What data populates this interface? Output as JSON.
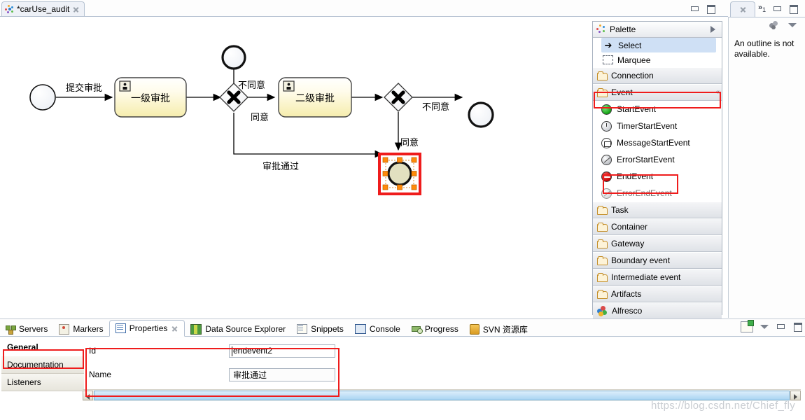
{
  "editor": {
    "tab_title": "*carUse_audit",
    "tab_icon": "bpmn-diagram-icon",
    "close_icon": "close-icon",
    "minimize_label": "minimize-icon",
    "maximize_label": "maximize-icon"
  },
  "diagram": {
    "nodes": [
      {
        "id": "startevent1",
        "type": "start-event",
        "label": ""
      },
      {
        "id": "usertask1",
        "type": "user-task",
        "label": "一级审批"
      },
      {
        "id": "exclusivegateway1",
        "type": "exclusive-gateway",
        "label": ""
      },
      {
        "id": "endevent1",
        "type": "end-event",
        "label": ""
      },
      {
        "id": "usertask2",
        "type": "user-task",
        "label": "二级审批"
      },
      {
        "id": "exclusivegateway2",
        "type": "exclusive-gateway",
        "label": ""
      },
      {
        "id": "endevent3",
        "type": "end-event",
        "label": ""
      },
      {
        "id": "endevent2",
        "type": "end-event",
        "label": "审批通过",
        "selected": true
      }
    ],
    "flow_labels": {
      "submit": "提交审批",
      "reject1": "不同意",
      "approve1": "同意",
      "reject2": "不同意",
      "approve2": "同意",
      "passed": "审批通过"
    },
    "selection_color": "#ef1c1c",
    "handle_color": "#ff8a0a"
  },
  "palette": {
    "title": "Palette",
    "title_icon": "palette-icon",
    "expand_icon": "chevron-right-icon",
    "tools": [
      {
        "label": "Select",
        "icon": "cursor-arrow-icon",
        "selected": true
      },
      {
        "label": "Marquee",
        "icon": "marquee-icon",
        "selected": false
      }
    ],
    "groups": [
      {
        "label": "Connection",
        "icon": "folder-icon",
        "expanded": false,
        "highlighted": false
      },
      {
        "label": "Event",
        "icon": "folder-icon",
        "expanded": true,
        "highlighted": true,
        "items": [
          {
            "label": "StartEvent",
            "icon": "start-event-icon"
          },
          {
            "label": "TimerStartEvent",
            "icon": "timer-start-event-icon"
          },
          {
            "label": "MessageStartEvent",
            "icon": "message-start-event-icon"
          },
          {
            "label": "ErrorStartEvent",
            "icon": "error-start-event-icon"
          },
          {
            "label": "EndEvent",
            "icon": "end-event-icon",
            "highlighted": true
          },
          {
            "label": "ErrorEndEvent",
            "icon": "error-end-event-icon"
          }
        ]
      },
      {
        "label": "Task",
        "icon": "folder-icon",
        "expanded": false,
        "highlighted": false
      },
      {
        "label": "Container",
        "icon": "folder-icon",
        "expanded": false,
        "highlighted": false
      },
      {
        "label": "Gateway",
        "icon": "folder-icon",
        "expanded": false,
        "highlighted": false
      },
      {
        "label": "Boundary event",
        "icon": "folder-icon",
        "expanded": false,
        "highlighted": false
      },
      {
        "label": "Intermediate event",
        "icon": "folder-icon",
        "expanded": false,
        "highlighted": false
      },
      {
        "label": "Artifacts",
        "icon": "folder-icon",
        "expanded": false,
        "highlighted": false
      },
      {
        "label": "Alfresco",
        "icon": "alfresco-icon",
        "expanded": false,
        "highlighted": false
      }
    ],
    "collapse_icon": "collapse-icon"
  },
  "outline": {
    "tab_icon": "outline-icon",
    "overflow_count": "1",
    "message": "An outline is not available.",
    "menu_icon": "view-menu-icon",
    "blob_icon": "outline-blob-icon",
    "minimize_label": "minimize-icon",
    "maximize_label": "maximize-icon"
  },
  "bottom_view": {
    "tabs": [
      {
        "label": "Servers",
        "icon": "servers-icon",
        "active": false
      },
      {
        "label": "Markers",
        "icon": "markers-icon",
        "active": false
      },
      {
        "label": "Properties",
        "icon": "properties-icon",
        "active": true,
        "closable": true
      },
      {
        "label": "Data Source Explorer",
        "icon": "datasource-icon",
        "active": false
      },
      {
        "label": "Snippets",
        "icon": "snippets-icon",
        "active": false
      },
      {
        "label": "Console",
        "icon": "console-icon",
        "active": false
      },
      {
        "label": "Progress",
        "icon": "progress-icon",
        "active": false
      },
      {
        "label": "SVN 资源库",
        "icon": "svn-icon",
        "active": false
      }
    ],
    "toolbar": [
      {
        "icon": "new-view-icon"
      },
      {
        "icon": "view-menu-icon"
      },
      {
        "icon": "minimize-icon"
      },
      {
        "icon": "maximize-icon"
      }
    ]
  },
  "properties": {
    "tabs": [
      {
        "label": "General",
        "active": true,
        "highlighted": true
      },
      {
        "label": "Documentation",
        "active": false
      },
      {
        "label": "Listeners",
        "active": false
      }
    ],
    "fields": [
      {
        "label": "Id",
        "value": "endevent2",
        "focused": true
      },
      {
        "label": "Name",
        "value": "审批通过",
        "focused": false
      }
    ],
    "highlight_color": "#ef1c1c"
  },
  "scrollbar": {
    "left_arrow": "scroll-left-icon",
    "right_arrow": "scroll-right-icon"
  },
  "watermark": "https://blog.csdn.net/Chief_fly"
}
